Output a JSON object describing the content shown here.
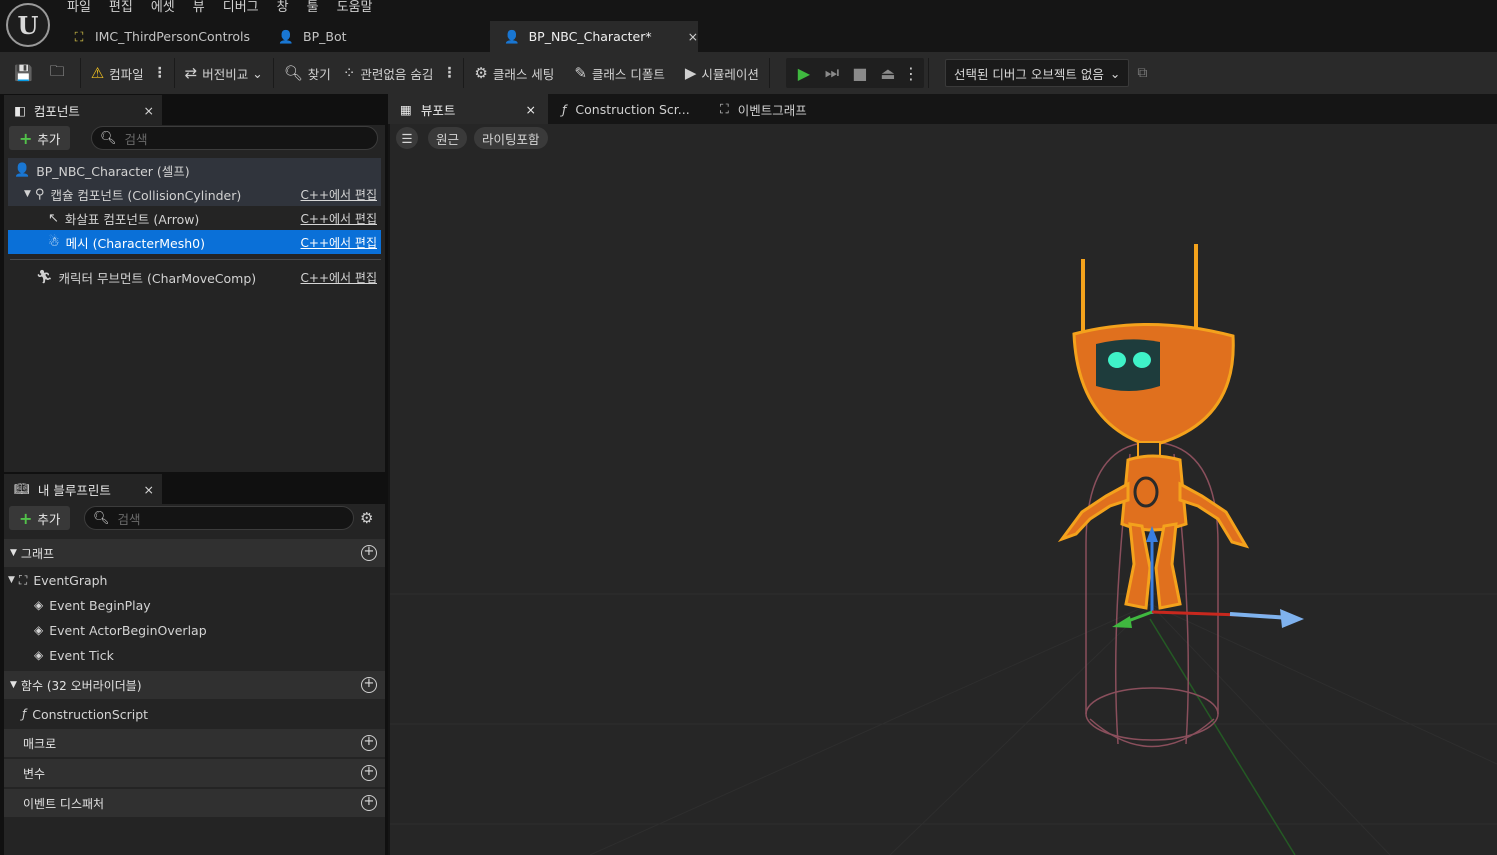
{
  "menu": [
    "파일",
    "편집",
    "에셋",
    "뷰",
    "디버그",
    "창",
    "툴",
    "도움말"
  ],
  "doc_tabs": [
    {
      "label": "IMC_ThirdPersonControls"
    },
    {
      "label": "BP_Bot"
    },
    {
      "label": "BP_NBC_Character*",
      "close": "×"
    }
  ],
  "toolbar": {
    "compile": "컴파일",
    "diff": "버전비교",
    "find": "찾기",
    "hide_unrelated": "관련없음 숨김",
    "class_settings": "클래스 세팅",
    "class_defaults": "클래스 디폴트",
    "simulation": "시뮬레이션",
    "debug_object": "선택된 디버그 오브젝트 없음"
  },
  "components_panel": {
    "title": "컴포넌트",
    "add": "추가",
    "search_placeholder": "검색",
    "tree": [
      {
        "label": "BP_NBC_Character (셀프)",
        "edit": ""
      },
      {
        "label": "캡슐 컴포넌트 (CollisionCylinder)",
        "edit": "C++에서 편집"
      },
      {
        "label": "화살표 컴포넌트 (Arrow)",
        "edit": "C++에서 편집"
      },
      {
        "label": "메시 (CharacterMesh0)",
        "edit": "C++에서 편집"
      },
      {
        "label": "캐릭터 무브먼트 (CharMoveComp)",
        "edit": "C++에서 편집"
      }
    ]
  },
  "blueprint_panel": {
    "title": "내 블루프린트",
    "add": "추가",
    "search_placeholder": "검색",
    "graphs_header": "그래프",
    "event_graph": "EventGraph",
    "events": [
      "Event BeginPlay",
      "Event ActorBeginOverlap",
      "Event Tick"
    ],
    "functions_header": "함수 (32 오버라이더블)",
    "construction_script": "ConstructionScript",
    "macros_header": "매크로",
    "variables_header": "변수",
    "dispatchers_header": "이벤트 디스패처"
  },
  "editor_tabs": [
    {
      "label": "뷰포트",
      "close": "×"
    },
    {
      "label": "Construction Scr..."
    },
    {
      "label": "이벤트그래프"
    }
  ],
  "viewport": {
    "perspective": "원근",
    "lighting": "라이팅포함"
  },
  "colors": {
    "selection": "#0a70d8",
    "robot_body": "#e0701e",
    "outline": "#f4a21c",
    "eyes": "#3ff2c8",
    "play": "#3fb83f"
  }
}
